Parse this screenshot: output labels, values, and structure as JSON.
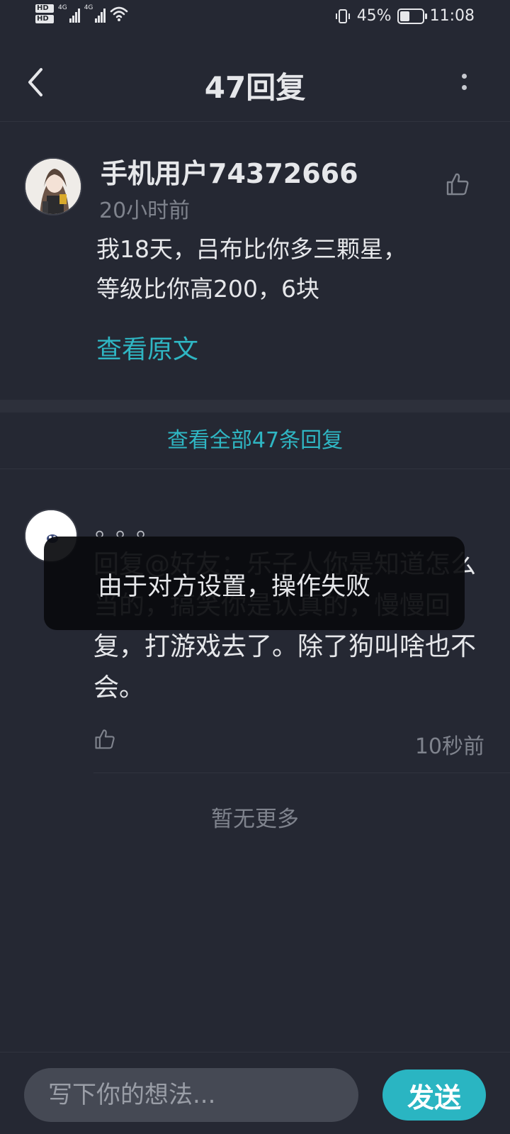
{
  "status_bar": {
    "hd1": "HD",
    "hd2": "HD",
    "net1": "4G",
    "net2": "4G",
    "battery_percent": "45%",
    "battery_level": 0.45,
    "time": "11:08"
  },
  "header": {
    "title": "47回复",
    "back_icon": "chevron-left-icon",
    "more_icon": "more-vertical-icon"
  },
  "main_comment": {
    "username": "手机用户74372666",
    "time": "20小时前",
    "content_line1": "我18天，吕布比你多三颗星，",
    "content_line2": "等级比你高200，6块",
    "view_original": "查看原文",
    "like_icon": "thumbs-up-icon"
  },
  "view_all_replies": "查看全部47条回复",
  "reply": {
    "username": "。。。",
    "content": "回复@好友：乐子人你是知道怎么当的，搞笑你是认真的，慢慢回复，打游戏去了。除了狗叫啥也不会。",
    "time": "10秒前",
    "like_icon": "thumbs-up-icon"
  },
  "no_more": "暂无更多",
  "toast": {
    "message": "由于对方设置，操作失败"
  },
  "composer": {
    "placeholder": "写下你的想法...",
    "send_label": "发送"
  },
  "colors": {
    "background": "#252833",
    "accent": "#2fb6c3",
    "send_button": "#2ab5c2"
  }
}
